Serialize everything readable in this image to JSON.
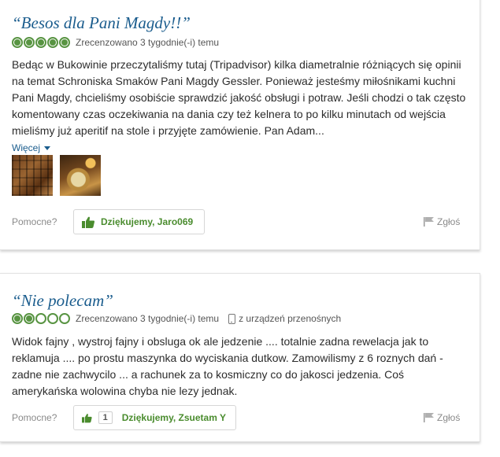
{
  "reviews": [
    {
      "title": "“Besos dla Pani Magdy!!”",
      "rating": 5,
      "date": "Zrecenzowano 3 tygodnie(-i) temu",
      "text": "Bedąc w Bukowinie przeczytaliśmy tutaj (Tripadvisor) kilka diametralnie różniących się opinii na temat Schroniska Smaków Pani Magdy Gessler. Ponieważ jesteśmy miłośnikami kuchni Pani Magdy, chcieliśmy osobiście sprawdzić jakość obsługi i potraw. Jeśli chodzi o tak często komentowany czas oczekiwania na dania czy też kelnera to po kilku minutach od wejścia mieliśmy już aperitif na stole i przyjęte zamówienie. Pan Adam...",
      "more_label": "Więcej",
      "helpful_label": "Pomocne?",
      "thanks_label": "Dziękujemy, Jaro069",
      "report_label": "Zgłoś"
    },
    {
      "title": "“Nie polecam”",
      "rating": 2,
      "date": "Zrecenzowano 3 tygodnie(-i) temu",
      "mobile_label": "z urządzeń przenośnych",
      "text": "Widok fajny , wystroj fajny i obsluga ok ale jedzenie .... totalnie zadna rewelacja jak to reklamuja .... po prostu maszynka do wyciskania dutkow. Zamowilismy z 6 roznych dań - zadne nie zachwycilo ... a rachunek za to kosmiczny co do jakosci jedzenia. Coś amerykańska wolowina chyba nie lezy jednak.",
      "helpful_label": "Pomocne?",
      "thanks_count": "1",
      "thanks_label": "Dziękujemy, Zsuetam Y",
      "report_label": "Zgłoś"
    }
  ],
  "colors": {
    "title": "#1a5c8d",
    "bubble": "#589442",
    "thanks_text": "#4a8c2e"
  }
}
